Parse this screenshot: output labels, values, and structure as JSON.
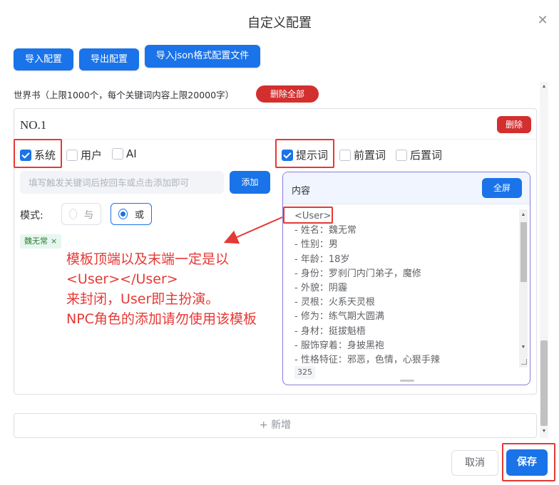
{
  "dialog": {
    "title": "自定义配置",
    "close_icon": "close-icon"
  },
  "toolbar": {
    "import_label": "导入配置",
    "export_label": "导出配置",
    "import_json_label": "导入json格式配置文件"
  },
  "worldbook": {
    "label": "世界书（上限1000个，每个关键词内容上限20000字）",
    "delete_all_label": "删除全部"
  },
  "entry": {
    "title": "NO.1",
    "delete_label": "删除",
    "checkboxes_left": [
      {
        "label": "系统",
        "checked": true
      },
      {
        "label": "用户",
        "checked": false
      },
      {
        "label": "AI",
        "checked": false
      }
    ],
    "checkboxes_right": [
      {
        "label": "提示词",
        "checked": true
      },
      {
        "label": "前置词",
        "checked": false
      },
      {
        "label": "后置词",
        "checked": false
      }
    ],
    "keyword_placeholder": "填写触发关键词后按回车或点击添加即可",
    "add_label": "添加",
    "mode_label": "模式:",
    "mode_options": [
      {
        "label": "与",
        "selected": false
      },
      {
        "label": "或",
        "selected": true
      }
    ],
    "tags": [
      {
        "label": "魏无常"
      }
    ],
    "tag_close_glyph": "×"
  },
  "annotation": {
    "lines": [
      "模板顶端以及末端一定是以",
      "<User></User>",
      "来封闭，User即主扮演。",
      "NPC角色的添加请勿使用该模板"
    ],
    "color": "#e53935"
  },
  "content_panel": {
    "header_label": "内容",
    "fullscreen_label": "全屏",
    "lines": [
      "<User>",
      "- 姓名：魏无常",
      "- 性别：男",
      "- 年龄：18岁",
      "- 身份：罗刹门内门弟子，魔修",
      "- 外貌：阴霾",
      "- 灵根：火系天灵根",
      "- 修为：练气期大圆满",
      "- 身材：挺拔魁梧",
      "- 服饰穿着：身披黑袍",
      "- 性格特征：邪恶，色情，心狠手辣"
    ],
    "char_count": "325"
  },
  "add_row_label": "+ 新增",
  "footer": {
    "cancel_label": "取消",
    "save_label": "保存"
  },
  "colors": {
    "primary": "#1a73e8",
    "danger": "#d32f2f",
    "highlight_outline": "#e53935",
    "tag_bg": "#e6f7ef"
  }
}
